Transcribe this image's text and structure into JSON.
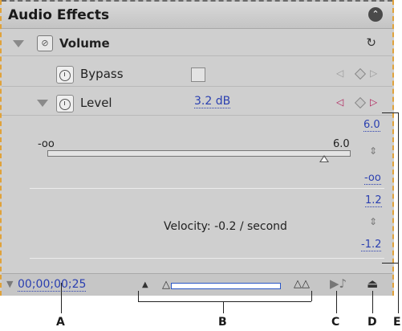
{
  "panel": {
    "title": "Audio Effects"
  },
  "effect": {
    "name": "Volume"
  },
  "bypass": {
    "label": "Bypass"
  },
  "level": {
    "label": "Level",
    "value": "3.2 dB"
  },
  "graph": {
    "value_max": "6.0",
    "slider_left": "-oo",
    "slider_right": "6.0",
    "value_min": "-oo",
    "velocity_max": "1.2",
    "velocity_text": "Velocity: -0.2 / second",
    "velocity_min": "-1.2"
  },
  "timeline": {
    "timecode": "00;00;00;25"
  },
  "callouts": {
    "a": "A",
    "b": "B",
    "c": "C",
    "d": "D",
    "e": "E"
  }
}
